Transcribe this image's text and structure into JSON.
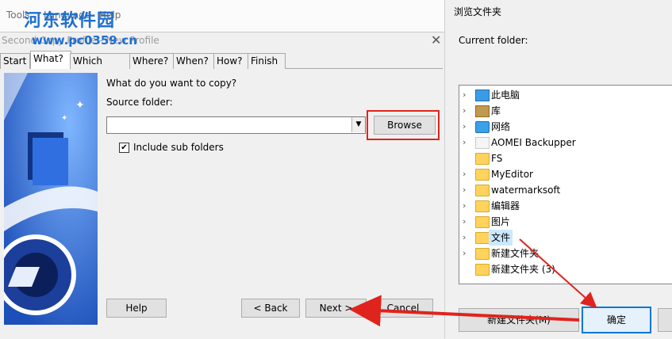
{
  "menubar": {
    "items": [
      "Tools",
      "Language",
      "Help"
    ]
  },
  "watermark": {
    "text": "河东软件园",
    "url": "www.pc0359.cn"
  },
  "window": {
    "title": "Second Copy Profile - New Profile",
    "tabs": [
      "Start",
      "What?",
      "Which files?",
      "Where?",
      "When?",
      "How?",
      "Finish"
    ],
    "active_tab": 1,
    "question": "What do you want to copy?",
    "source_label": "Source folder:",
    "source_value": "",
    "browse_label": "Browse",
    "include_sub_label": "Include sub folders",
    "include_sub_checked": true,
    "help_label": "Help",
    "back_label": "< Back",
    "next_label": "Next >",
    "cancel_label": "Cancel"
  },
  "dialog": {
    "title": "浏览文件夹",
    "current_folder_label": "Current folder:",
    "tree": [
      {
        "label": "此电脑",
        "icon": "computer-icon",
        "expandable": true
      },
      {
        "label": "库",
        "icon": "library-icon",
        "expandable": true
      },
      {
        "label": "网络",
        "icon": "network-icon",
        "expandable": true
      },
      {
        "label": "AOMEI Backupper",
        "icon": "folder-icon",
        "expandable": true
      },
      {
        "label": "FS",
        "icon": "folder-icon",
        "expandable": false
      },
      {
        "label": "MyEditor",
        "icon": "folder-icon",
        "expandable": true
      },
      {
        "label": "watermarksoft",
        "icon": "folder-icon",
        "expandable": true
      },
      {
        "label": "编辑器",
        "icon": "folder-icon",
        "expandable": true
      },
      {
        "label": "图片",
        "icon": "folder-icon",
        "expandable": true
      },
      {
        "label": "文件",
        "icon": "folder-icon",
        "expandable": true,
        "selected": true
      },
      {
        "label": "新建文件夹",
        "icon": "folder-icon",
        "expandable": true
      },
      {
        "label": "新建文件夹 (3)",
        "icon": "folder-icon",
        "expandable": false
      }
    ],
    "new_folder_label": "新建文件夹(M)",
    "ok_label": "确定"
  },
  "colors": {
    "highlight": "#e0231c",
    "accent": "#0078d7",
    "selection": "#cce8ff"
  }
}
